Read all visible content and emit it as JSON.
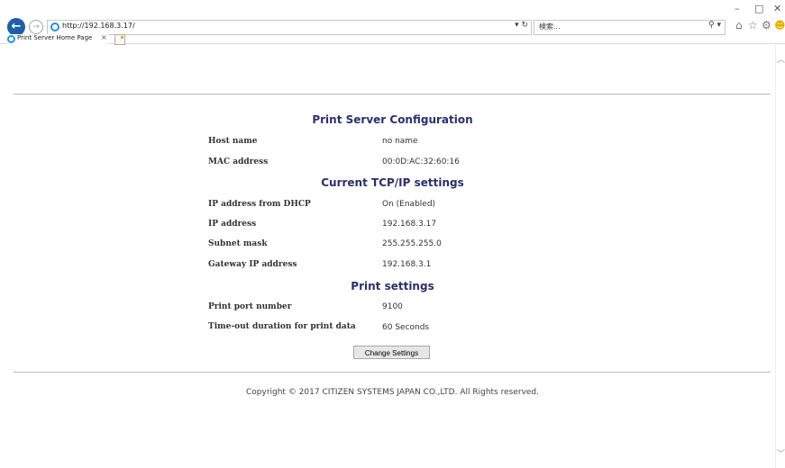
{
  "browser": {
    "url": "http://192.168.3.17/",
    "search_placeholder": "検索...",
    "tab_title": "Print Server Home Page",
    "tab_close": "×",
    "refresh_symbol": "▾ ↻",
    "search_symbol": "⚲ ▾",
    "window_controls": {
      "minimize": "–",
      "maximize": "□",
      "close": "✕"
    }
  },
  "page": {
    "sections": {
      "config_title": "Print Server Configuration",
      "tcpip_title": "Current TCP/IP settings",
      "print_title": "Print settings"
    },
    "rows": {
      "host_name": {
        "label": "Host name",
        "value": "no name"
      },
      "mac": {
        "label": "MAC address",
        "value": "00:0D:AC:32:60:16"
      },
      "dhcp": {
        "label": "IP address from DHCP",
        "value": "On (Enabled)"
      },
      "ip": {
        "label": "IP address",
        "value": "192.168.3.17"
      },
      "subnet": {
        "label": "Subnet mask",
        "value": "255.255.255.0"
      },
      "gateway": {
        "label": "Gateway IP address",
        "value": "192.168.3.1"
      },
      "port": {
        "label": "Print port number",
        "value": "9100"
      },
      "timeout": {
        "label": "Time-out duration for print data",
        "value": "60 Seconds"
      }
    },
    "change_button": "Change Settings",
    "copyright": "Copyright © 2017 CITIZEN SYSTEMS JAPAN CO.,LTD. All Rights reserved."
  }
}
